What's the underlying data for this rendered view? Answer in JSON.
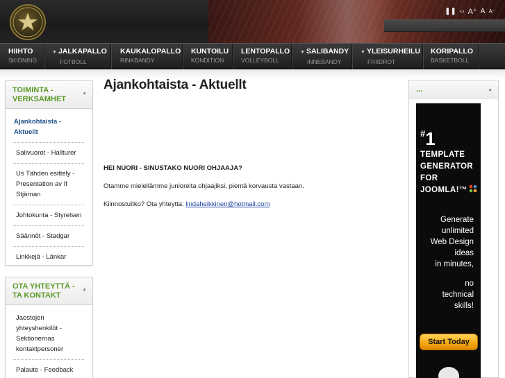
{
  "header": {
    "logo_top_text": "IF Stjärnan · US Tähti",
    "logo_bottom_text": "Porvoo · Borgå",
    "controls": {
      "pause_icon": "❚❚",
      "prev_next_icon": "‹›",
      "font_increase": "A⁺",
      "font_reset": "A",
      "font_decrease": "A⁻"
    }
  },
  "nav": {
    "items": [
      {
        "main": "HIIHTO",
        "sub": "SKIDNING",
        "has_dropdown": false
      },
      {
        "main": "JALKAPALLO",
        "sub": "FOTBOLL",
        "has_dropdown": true
      },
      {
        "main": "KAUKALOPALLO",
        "sub": "RINKBANDY",
        "has_dropdown": false
      },
      {
        "main": "KUNTOILU",
        "sub": "KONDITION",
        "has_dropdown": false
      },
      {
        "main": "LENTOPALLO",
        "sub": "VOLLEYBOLL",
        "has_dropdown": false
      },
      {
        "main": "SALIBANDY",
        "sub": "INNEBANDY",
        "has_dropdown": true
      },
      {
        "main": "YLEISURHEILU",
        "sub": "FRIIDROT",
        "has_dropdown": true
      },
      {
        "main": "KORIPALLO",
        "sub": "BASKETBOLL",
        "has_dropdown": false
      }
    ]
  },
  "sidebar": {
    "module1": {
      "title": "TOIMINTA - VERKSAMHET",
      "items": [
        {
          "label": "Ajankohtaista - Aktuellt",
          "active": true
        },
        {
          "label": "Salivuorot - Hallturer",
          "active": false
        },
        {
          "label": "Us Tähden esittely - Presentation av If Stjärnan",
          "active": false
        },
        {
          "label": "Johtokunta - Styrelsen",
          "active": false
        },
        {
          "label": "Säännöt - Stadgar",
          "active": false
        },
        {
          "label": "Linkkejä - Länkar",
          "active": false
        }
      ]
    },
    "module2": {
      "title": "OTA YHTEYTTÄ - TA KONTAKT",
      "items": [
        {
          "label": "Jaostojen yhteyshenkilöt - Sektionernas kontaktpersoner"
        },
        {
          "label": "Palaute - Feedback"
        }
      ]
    }
  },
  "main": {
    "title": "Ajankohtaista - Aktuellt",
    "heading": "HEI NUORI - SINUSTAKO NUORI OHJAAJA?",
    "paragraph1": "Otamme mielellämme junioreita ohjaajiksi, pientä korvausta vastaan.",
    "contact_prefix": "Kiinnostuitko? Ota yhteytta: ",
    "contact_email": "lindaheikkinen@hotmail.com"
  },
  "right_module": {
    "title": "...",
    "ad": {
      "rank": "1",
      "line1": "TEMPLATE",
      "line2": "GENERATOR",
      "line3": "FOR",
      "line4": "JOOMLA!™",
      "gen1": "Generate",
      "gen2": "unlimited",
      "gen3": "Web Design",
      "gen4": "ideas",
      "gen5": "in minutes,",
      "gen6": "no",
      "gen7": "technical",
      "gen8": "skills!",
      "button": "Start Today"
    }
  },
  "colors": {
    "accent_green": "#5a9a28",
    "link_blue": "#1a3f9e",
    "active_blue": "#1d4f8a",
    "button_orange": "#f5a914"
  }
}
